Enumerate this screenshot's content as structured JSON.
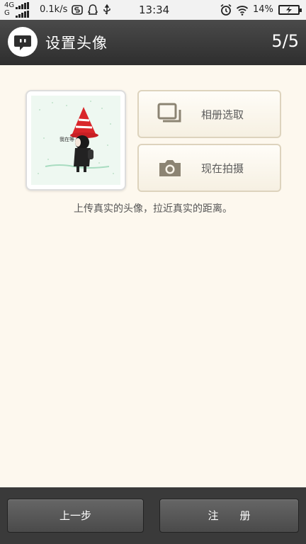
{
  "status_bar": {
    "network_top": "4G",
    "network_bottom": "G",
    "speed": "0.1k/s",
    "time": "13:34",
    "battery": "14%",
    "icons": [
      "signal-icon",
      "app-s-icon",
      "qq-icon",
      "usb-icon",
      "alarm-icon",
      "wifi-icon",
      "battery-charging-icon"
    ]
  },
  "header": {
    "title": "设置头像",
    "step": "5/5",
    "logo_icon": "chat-bubble-icon"
  },
  "options": {
    "album_label": "相册选取",
    "album_icon": "photo-stack-icon",
    "camera_label": "现在拍摄",
    "camera_icon": "camera-icon"
  },
  "avatar": {
    "image_text": "我在等"
  },
  "tip": "上传真实的头像，拉近真实的距离。",
  "footer": {
    "prev_label": "上一步",
    "register_label": "注册"
  },
  "colors": {
    "background": "#fdf8ee",
    "header": "#3a3a3a",
    "hat": "#d9262a"
  }
}
